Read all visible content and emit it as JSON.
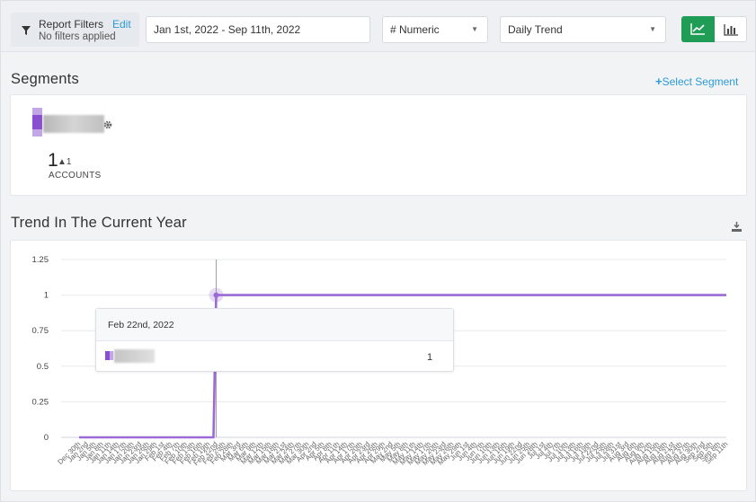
{
  "filters": {
    "title": "Report Filters",
    "edit_label": "Edit",
    "subtitle": "No filters applied",
    "date_range": "Jan 1st, 2022 - Sep 11th, 2022",
    "metric_select": "# Numeric",
    "view_select": "Daily Trend",
    "chart_toggle": {
      "active": "line-chart-icon",
      "inactive": "bar-chart-icon",
      "active_color": "#1f9d57"
    }
  },
  "segments": {
    "title": "Segments",
    "select_label": "Select Segment",
    "item": {
      "count": "1",
      "delta": "1",
      "unit_label": "ACCOUNTS",
      "color": "#8a4fd0"
    }
  },
  "trend": {
    "title": "Trend In The Current Year",
    "tooltip": {
      "date": "Feb 22nd, 2022",
      "value": "1"
    }
  },
  "chart_data": {
    "type": "line",
    "title": "",
    "xlabel": "",
    "ylabel": "",
    "ylim": [
      0,
      1.25
    ],
    "yticks": [
      "0",
      "0.25",
      "0.5",
      "0.75",
      "1",
      "1.25"
    ],
    "x_start": "Dec 30th",
    "x_end": "Sep 11th",
    "step_index": 54,
    "highlight_index": 54,
    "grid": true,
    "series": [
      {
        "color": "#9b6ad6",
        "values": [
          0,
          1
        ]
      }
    ]
  }
}
